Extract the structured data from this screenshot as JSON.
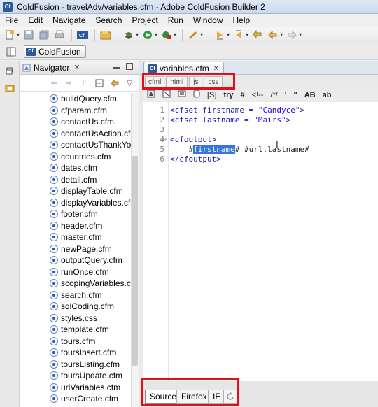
{
  "window": {
    "title": "ColdFusion - travelAdv/variables.cfm - Adobe ColdFusion Builder 2",
    "app_icon": "Cf"
  },
  "menu": [
    "File",
    "Edit",
    "Navigate",
    "Search",
    "Project",
    "Run",
    "Window",
    "Help"
  ],
  "perspective": {
    "label": "ColdFusion",
    "badge": "Cf"
  },
  "navigator": {
    "title": "Navigator",
    "files": [
      "buildQuery.cfm",
      "cfparam.cfm",
      "contactUs.cfm",
      "contactUsAction.cf",
      "contactUsThankYo",
      "countries.cfm",
      "dates.cfm",
      "detail.cfm",
      "displayTable.cfm",
      "displayVariables.cfr",
      "footer.cfm",
      "header.cfm",
      "master.cfm",
      "newPage.cfm",
      "outputQuery.cfm",
      "runOnce.cfm",
      "scopingVariables.cf",
      "search.cfm",
      "sqlCoding.cfm",
      "styles.css",
      "template.cfm",
      "tours.cfm",
      "toursInsert.cfm",
      "toursListing.cfm",
      "toursUpdate.cfm",
      "urlVariables.cfm",
      "userCreate.cfm"
    ]
  },
  "editor": {
    "tab_label": "variables.cfm",
    "lang_tabs": [
      "cfml",
      "html",
      "js",
      "css"
    ],
    "code_toolbar": [
      "[S]",
      "try",
      "#",
      "<!--",
      "/*/",
      "'",
      "\"",
      "AB",
      "ab"
    ],
    "lines": [
      {
        "n": "1",
        "a": "<cfset firstname = ",
        "s": "\"Candyce\"",
        "b": ">"
      },
      {
        "n": "2",
        "a": "<cfset lastname = ",
        "s": "\"Mairs\"",
        "b": ">"
      },
      {
        "n": "3",
        "a": "",
        "s": "",
        "b": ""
      },
      {
        "n": "4",
        "a": "<cfoutput>",
        "s": "",
        "b": ""
      },
      {
        "n": "5",
        "pre": "    #",
        "hl": "firstname",
        "post": "# #url.lastname#"
      },
      {
        "n": "6",
        "a": "</cfoutput>",
        "s": "",
        "b": ""
      }
    ],
    "bottom_tabs": [
      "Source",
      "Firefox",
      "IE"
    ]
  }
}
